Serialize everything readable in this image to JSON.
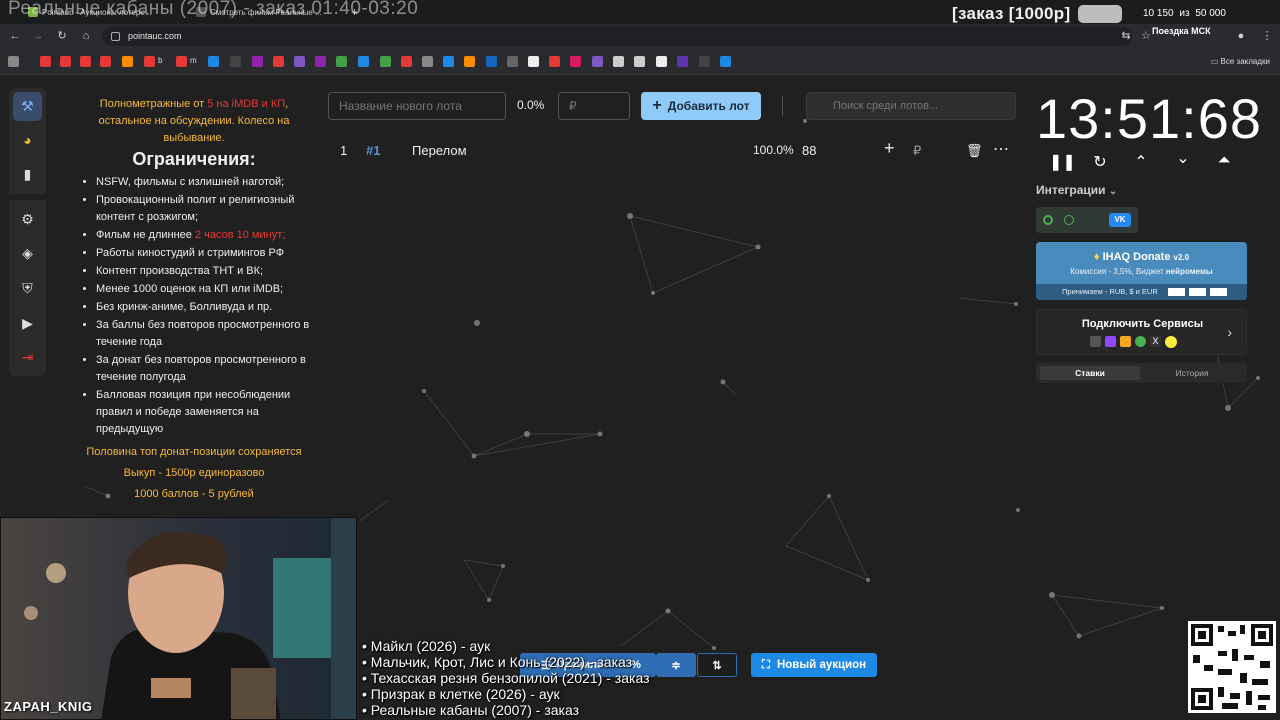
{
  "overlay_title": "Реальные кабаны (2007) - заказ 01:40-03:20",
  "browser": {
    "tabs": [
      {
        "label": "Pointauc - Аукционы лотере..."
      },
      {
        "label": "Смотреть фильм Реальные ..."
      }
    ],
    "url": "pointauc.com",
    "bookmarks_all": "Все закладки",
    "bookmark_labels": [
      "b",
      "m"
    ]
  },
  "stream": {
    "order_badge": "[заказ [1000р]",
    "goal_current": "10 150",
    "goal_sep": "из",
    "goal_total": "50 000",
    "goal_title": "Поездка МСК",
    "webcam_name": "ZAPAH_KNIG"
  },
  "sidebar": {
    "icons": [
      "gavel-icon",
      "wheel-icon",
      "stats-icon",
      "gear-icon",
      "layers-icon",
      "shield-icon",
      "video-icon",
      "logout-icon"
    ]
  },
  "rules": {
    "intro_part1": "Полнометражные от ",
    "intro_red": "5 на iMDB и КП",
    "intro_part2": ", остальное на обсуждении. Колесо на выбывание.",
    "heading": "Ограничения:",
    "items": [
      {
        "text": "NSFW, фильмы с излишней наготой;"
      },
      {
        "text": "Провокационный полит и религиозный контент с розжигом;"
      },
      {
        "text": "Фильм не длиннее ",
        "red": "2 часов 10 минут;"
      },
      {
        "text": "Работы киностудий и стримингов РФ"
      },
      {
        "text": "Контент производства ТНТ и ВК;"
      },
      {
        "text": "Менее 1000 оценок на КП или iMDB;"
      },
      {
        "text": "Без кринж-аниме, Болливуда и пр."
      },
      {
        "text": "За баллы без повторов просмотренного в течение года"
      },
      {
        "text": "За донат без повторов просмотренного в течение полугода"
      },
      {
        "text": "Балловая позиция при несоблюдении правил и победе заменяется на предыдущую"
      }
    ],
    "footnotes": [
      "Половина топ донат-позиции сохраняется",
      "Выкуп - 1500р единоразово",
      "1000 баллов - 5 рублей"
    ]
  },
  "controls": {
    "lot_placeholder": "Название нового лота",
    "percent": "0.0%",
    "rub_placeholder": "₽",
    "add_button": "Добавить лот",
    "search_placeholder": "Поиск среди лотов..."
  },
  "lots": [
    {
      "index": "1",
      "id": "#1",
      "name": "Перелом",
      "percent": "100.0%",
      "amount": "88",
      "currency": "₽"
    }
  ],
  "timer": {
    "value": "13:51:68"
  },
  "integrations": {
    "label": "Интеграции",
    "vk_label": "VK"
  },
  "donate": {
    "title": "IHAQ Donate",
    "version": "v2.0",
    "subtitle_part1": "Комиссия - 3,5%, Виджет ",
    "subtitle_bold": "нейромемы",
    "accept": "Принимаем - RUB, $ и EUR"
  },
  "services": {
    "title": "Подключить Сервисы"
  },
  "side_tabs": {
    "active": "Ставки",
    "inactive": "История"
  },
  "bottom": {
    "rules_button": "Правила",
    "percent_button": "%",
    "new_auction": "Новый аукцион"
  },
  "history": [
    "• Майкл (2026) - аук",
    "• Мальчик, Крот, Лис и Конь (2022) - заказ",
    "• Техасская резня бензопилой (2021) - заказ",
    "• Призрак в клетке (2026) - аук",
    "• Реальные кабаны (2007) - заказ"
  ]
}
